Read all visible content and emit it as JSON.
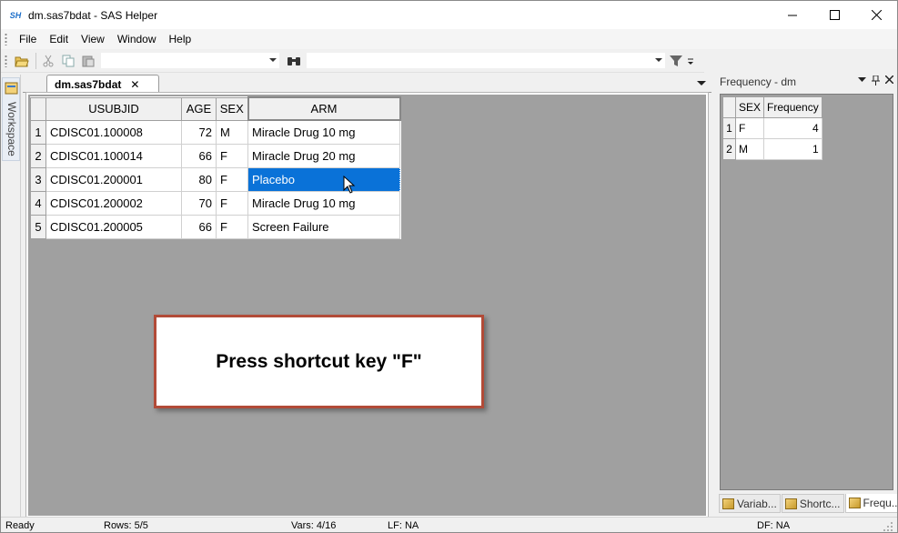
{
  "window": {
    "icon_text": "SH",
    "title": "dm.sas7bdat - SAS Helper"
  },
  "menu": [
    "File",
    "Edit",
    "View",
    "Window",
    "Help"
  ],
  "workspace": {
    "label": "Workspace"
  },
  "document": {
    "tab_label": "dm.sas7bdat",
    "close_glyph": "✕",
    "columns": [
      "USUBJID",
      "AGE",
      "SEX",
      "ARM"
    ],
    "rows": [
      {
        "n": "1",
        "usubjid": "CDISC01.100008",
        "age": "72",
        "sex": "M",
        "arm": "Miracle Drug 10 mg"
      },
      {
        "n": "2",
        "usubjid": "CDISC01.100014",
        "age": "66",
        "sex": "F",
        "arm": "Miracle Drug 20 mg"
      },
      {
        "n": "3",
        "usubjid": "CDISC01.200001",
        "age": "80",
        "sex": "F",
        "arm": "Placebo"
      },
      {
        "n": "4",
        "usubjid": "CDISC01.200002",
        "age": "70",
        "sex": "F",
        "arm": "Miracle Drug 10 mg"
      },
      {
        "n": "5",
        "usubjid": "CDISC01.200005",
        "age": "66",
        "sex": "F",
        "arm": "Screen Failure"
      }
    ],
    "selected_cell": {
      "row": 3,
      "column": "ARM"
    }
  },
  "callout": {
    "text": "Press shortcut key \"F\""
  },
  "frequency_panel": {
    "title": "Frequency - dm",
    "columns": [
      "SEX",
      "Frequency"
    ],
    "rows": [
      {
        "n": "1",
        "sex": "F",
        "freq": "4"
      },
      {
        "n": "2",
        "sex": "M",
        "freq": "1"
      }
    ],
    "tabs": [
      "Variab...",
      "Shortc...",
      "Frequ..."
    ],
    "active_tab": "Frequ..."
  },
  "status": {
    "state": "Ready",
    "rows": "Rows: 5/5",
    "vars": "Vars: 4/16",
    "lf": "LF: NA",
    "df": "DF: NA"
  },
  "colors": {
    "selection": "#0a72d8",
    "callout_border": "#b24b38",
    "grid_background": "#a0a0a0"
  }
}
